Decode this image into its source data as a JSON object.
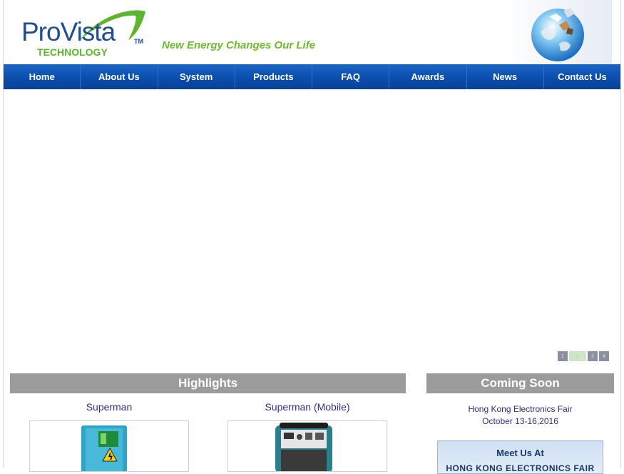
{
  "header": {
    "logo_main": "ProVista",
    "logo_sub": "TECHNOLOGY",
    "logo_tm": "TM",
    "tagline": "New Energy Changes Our Life"
  },
  "nav": {
    "items": [
      {
        "label": "Home"
      },
      {
        "label": "About Us"
      },
      {
        "label": "System"
      },
      {
        "label": "Products"
      },
      {
        "label": "FAQ"
      },
      {
        "label": "Awards"
      },
      {
        "label": "News"
      },
      {
        "label": "Contact Us"
      }
    ]
  },
  "slider": {
    "pages": [
      "1",
      "2",
      "3",
      "4"
    ],
    "active_page": 2
  },
  "highlights": {
    "title": "Highlights",
    "products": [
      {
        "name": "Superman"
      },
      {
        "name": "Superman (Mobile)"
      }
    ]
  },
  "coming_soon": {
    "title": "Coming Soon",
    "event_name": "Hong Kong Electronics Fair",
    "event_date": "October 13-16,2016",
    "promo_title": "Meet Us At",
    "promo_sub": "HONG KONG ELECTRONICS FAIR"
  },
  "colors": {
    "brand_blue": "#1f4e96",
    "brand_green": "#5db52e",
    "nav_blue": "#0d4fae",
    "section_gray": "#9b9b9b"
  }
}
